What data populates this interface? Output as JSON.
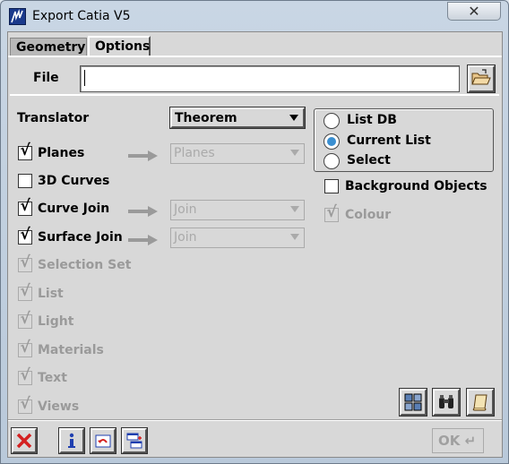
{
  "window": {
    "title": "Export Catia V5",
    "close_glyph": "✕"
  },
  "tabs": [
    {
      "label": "Geometry",
      "selected": false
    },
    {
      "label": "Options",
      "selected": true
    }
  ],
  "file": {
    "label": "File",
    "value": ""
  },
  "translator": {
    "label": "Translator",
    "value": "Theorem"
  },
  "options": {
    "planes": {
      "label": "Planes",
      "checked": true,
      "combo": "Planes"
    },
    "curves_3d": {
      "label": "3D Curves",
      "checked": false
    },
    "curve_join": {
      "label": "Curve Join",
      "checked": true,
      "combo": "Join"
    },
    "surface_join": {
      "label": "Surface Join",
      "checked": true,
      "combo": "Join"
    },
    "selection_set": {
      "label": "Selection Set",
      "checked": true,
      "enabled": false
    },
    "list": {
      "label": "List",
      "checked": true,
      "enabled": false
    },
    "light": {
      "label": "Light",
      "checked": true,
      "enabled": false
    },
    "materials": {
      "label": "Materials",
      "checked": true,
      "enabled": false
    },
    "text": {
      "label": "Text",
      "checked": true,
      "enabled": false
    },
    "views": {
      "label": "Views",
      "checked": true,
      "enabled": false
    }
  },
  "source": {
    "items": [
      {
        "label": "List DB",
        "selected": false
      },
      {
        "label": "Current List",
        "selected": true
      },
      {
        "label": "Select",
        "selected": false
      }
    ]
  },
  "background_objects": {
    "label": "Background Objects",
    "checked": false
  },
  "colour": {
    "label": "Colour",
    "checked": true,
    "enabled": false
  },
  "check_glyph": "√",
  "footer": {
    "ok_label": "OK ↵"
  },
  "colors": {
    "radio_selected": "#3a8fd1",
    "cancel_red": "#d42020",
    "info_blue": "#1f3fb0"
  }
}
